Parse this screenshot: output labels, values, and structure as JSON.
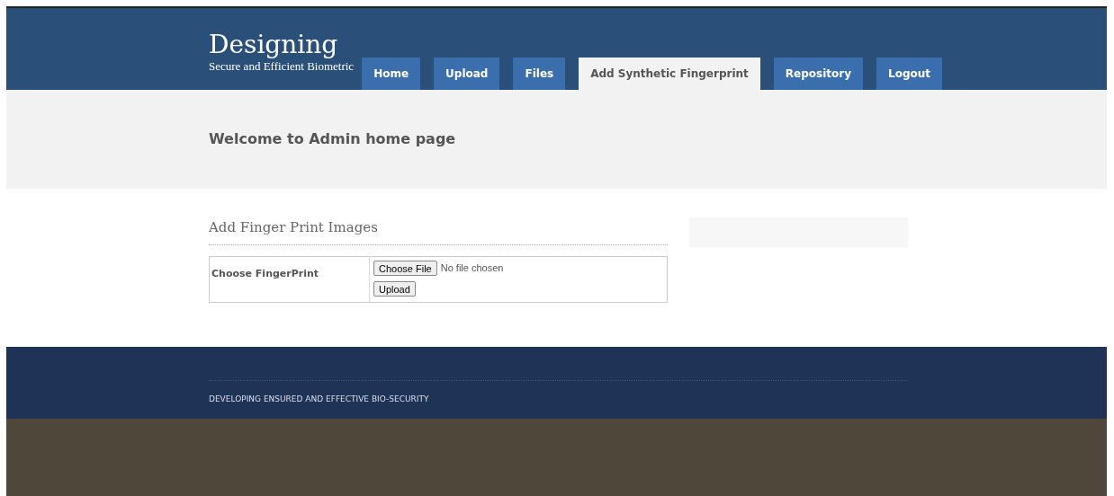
{
  "header": {
    "title": "Designing",
    "subtitle": "Secure and Efficient Biometric"
  },
  "nav": [
    {
      "label": "Home",
      "selected": false
    },
    {
      "label": "Upload",
      "selected": false
    },
    {
      "label": "Files",
      "selected": false
    },
    {
      "label": "Add Synthetic Fingerprint",
      "selected": true
    },
    {
      "label": "Repository",
      "selected": false
    },
    {
      "label": "Logout",
      "selected": false
    }
  ],
  "banner": {
    "heading": "Welcome to Admin home page"
  },
  "form": {
    "title": "Add Finger Print Images",
    "label": "Choose FingerPrint",
    "file_button": "Choose File",
    "file_status": "No file chosen",
    "submit": "Upload"
  },
  "footer": {
    "text": "DEVELOPING ENSURED AND EFFECTIVE BIO-SECURITY"
  }
}
